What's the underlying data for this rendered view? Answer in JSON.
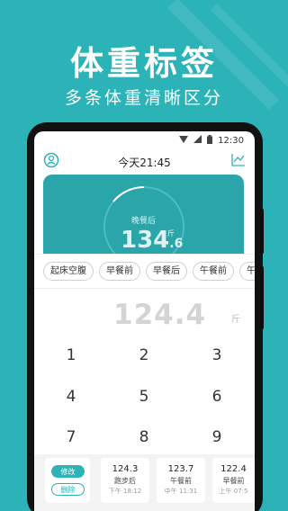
{
  "promo": {
    "title": "体重标签",
    "subtitle": "多条体重清晰区分"
  },
  "status_bar": {
    "time": "12:30",
    "icons": [
      "wifi-icon",
      "signal-icon",
      "battery-icon"
    ]
  },
  "app_bar": {
    "title": "今天21:45",
    "left_icon": "avatar-icon",
    "right_icon": "trend-icon"
  },
  "weight_card": {
    "meal": "晚餐后",
    "weight_int": "134",
    "weight_dec": ".6",
    "unit": "斤"
  },
  "tags": [
    "起床空腹",
    "早餐前",
    "早餐后",
    "午餐前",
    "午"
  ],
  "entry": {
    "value": "124.4",
    "unit": "斤"
  },
  "keypad": [
    "1",
    "2",
    "3",
    "4",
    "5",
    "6",
    "7",
    "8",
    "9"
  ],
  "records": {
    "edit_label": "修改",
    "delete_label": "删除",
    "items": [
      {
        "weight": "124.3",
        "meal": "跑步后",
        "time": "下午 18:12"
      },
      {
        "weight": "123.7",
        "meal": "午餐前",
        "time": "中午 11:31"
      },
      {
        "weight": "122.4",
        "meal": "早餐前",
        "time": "上午 07:5"
      }
    ]
  },
  "colors": {
    "brand": "#2cb3b8",
    "card": "#2aa5aa"
  }
}
